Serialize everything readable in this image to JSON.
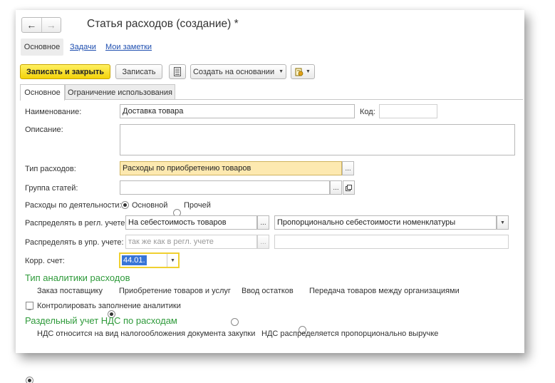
{
  "window": {
    "title": "Статья расходов (создание) *"
  },
  "nav": {
    "back_icon": "←",
    "forward_icon": "→"
  },
  "top_tabs": {
    "main": "Основное",
    "tasks": "Задачи",
    "notes": "Мои заметки"
  },
  "toolbar": {
    "save_close": "Записать и закрыть",
    "save": "Записать",
    "create_based": "Создать на основании"
  },
  "form_tabs": {
    "main": "Основное",
    "usage_limit": "Ограничение использования"
  },
  "fields": {
    "name_label": "Наименование:",
    "name_value": "Доставка товара",
    "code_label": "Код:",
    "code_value": "",
    "description_label": "Описание:",
    "description_value": "",
    "expense_type_label": "Тип расходов:",
    "expense_type_value": "Расходы по приобретению товаров",
    "group_label": "Группа статей:",
    "group_value": "",
    "activity_label": "Расходы по деятельности:",
    "activity_options": [
      "Основной",
      "Прочей"
    ],
    "activity_selected": "Основной",
    "distribute_reg_label": "Распределять в регл. учете:",
    "distribute_reg_value": "На себестоимость товаров",
    "distribute_reg_method": "Пропорционально себестоимости номенклатуры",
    "distribute_mgmt_label": "Распределять в упр. учете:",
    "distribute_mgmt_placeholder": "так же как в регл. учете",
    "corr_account_label": "Корр. счет:",
    "corr_account_value": "44.01."
  },
  "analytics": {
    "title": "Тип аналитики расходов",
    "options": [
      "Заказ поставщику",
      "Приобретение товаров и услуг",
      "Ввод остатков",
      "Передача товаров между организациями"
    ],
    "selected": "Приобретение товаров и услуг",
    "control_label": "Контролировать заполнение аналитики"
  },
  "vat": {
    "title": "Раздельный учет НДС по расходам",
    "options": [
      "НДС относится на вид налогообложения документа закупки",
      "НДС распределяется пропорционально выручке"
    ],
    "selected": "НДС относится на вид налогообложения документа закупки"
  }
}
